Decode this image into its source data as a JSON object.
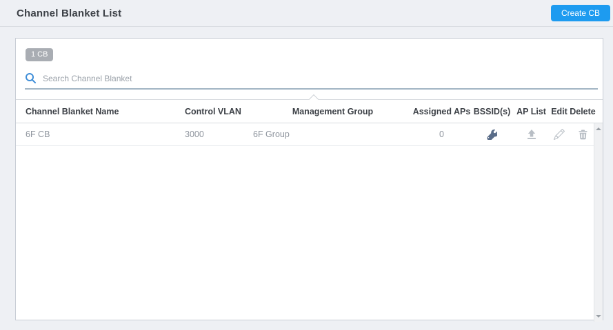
{
  "header": {
    "title": "Channel Blanket List",
    "create_button_label": "Create CB"
  },
  "panel": {
    "count_badge": "1 CB",
    "search": {
      "placeholder": "Search Channel Blanket",
      "icon": "search-icon"
    }
  },
  "table": {
    "columns": [
      "Channel Blanket Name",
      "Control VLAN",
      "Management Group",
      "Assigned APs",
      "BSSID(s)",
      "AP List",
      "Edit",
      "Delete"
    ],
    "rows": [
      {
        "name": "6F CB",
        "control_vlan": "3000",
        "management_group": "6F Group",
        "assigned_aps": "0",
        "bssid_icon": "wrench-icon",
        "ap_list_icon": "upload-icon",
        "edit_icon": "pencil-icon",
        "delete_icon": "trash-icon"
      }
    ]
  },
  "scrollbar": {
    "up_icon": "triangle-up-icon",
    "down_icon": "triangle-down-icon"
  },
  "colors": {
    "accent": "#1d9bf0",
    "badge_bg": "#a9adb3",
    "search_underline": "#a2b5c4",
    "search_icon": "#3f8ed8",
    "wrench_icon": "#5a6d89",
    "muted_icon": "#b8bec5",
    "row_text": "#8f959e",
    "header_text": "#3d4147"
  }
}
